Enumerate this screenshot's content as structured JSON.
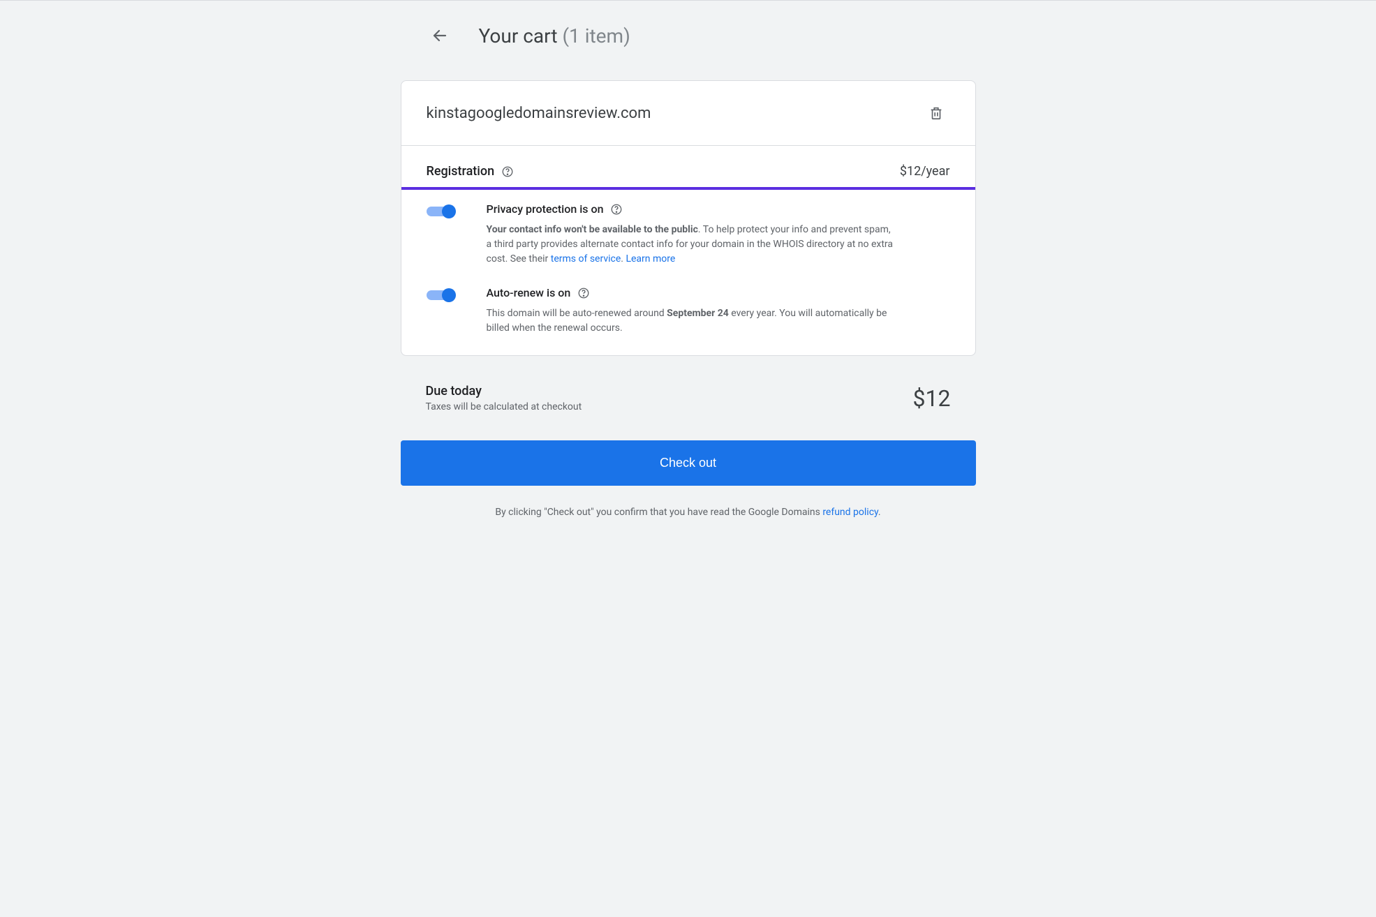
{
  "header": {
    "title": "Your cart ",
    "count": "(1 item)"
  },
  "cart": {
    "domain": "kinstagoogledomainsreview.com",
    "registration_label": "Registration",
    "price": "$12/year",
    "privacy": {
      "title": "Privacy protection is on",
      "desc_bold": "Your contact info won't be available to the public",
      "desc_rest": ". To help protect your info and prevent spam, a third party provides alternate contact info for your domain in the WHOIS directory at no extra cost. See their ",
      "terms_link": "terms of service",
      "learn_more": "Learn more"
    },
    "autorenew": {
      "title": "Auto-renew is on",
      "desc_start": "This domain will be auto-renewed around ",
      "date": "September 24",
      "desc_end": " every year. You will automatically be billed when the renewal occurs."
    }
  },
  "due": {
    "title": "Due today",
    "subtitle": "Taxes will be calculated at checkout",
    "amount": "$12"
  },
  "checkout": {
    "button": "Check out",
    "confirm_pre": "By clicking \"Check out\" you confirm that you have read the Google Domains ",
    "refund_link": "refund policy",
    "period": "."
  }
}
